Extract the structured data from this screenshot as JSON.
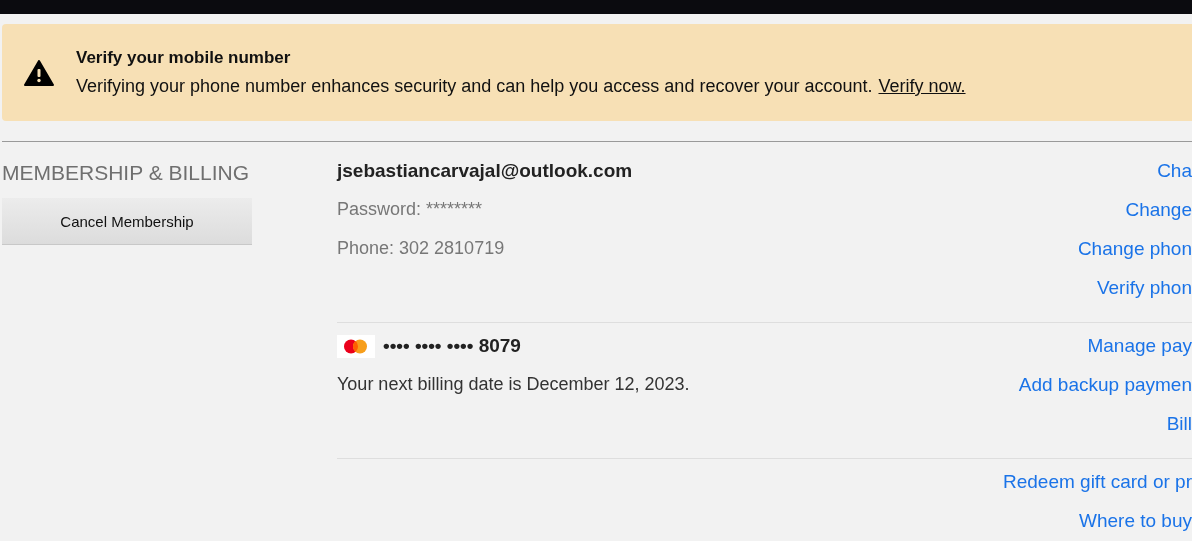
{
  "banner": {
    "title": "Verify your mobile number",
    "message": "Verifying your phone number enhances security and can help you access and recover your account.",
    "link": "Verify now."
  },
  "sidebar": {
    "heading": "MEMBERSHIP & BILLING",
    "button": "Cancel Membership"
  },
  "sections": [
    {
      "details": [
        {
          "kind": "email",
          "text": "jsebastiancarvajal@outlook.com"
        },
        {
          "kind": "muted",
          "text": "Password: ********"
        },
        {
          "kind": "muted",
          "text": "Phone: 302 2810719"
        }
      ],
      "links": [
        "Cha",
        "Change",
        "Change phon",
        "Verify phon"
      ]
    },
    {
      "details": [
        {
          "kind": "card",
          "text": "•••• •••• •••• 8079"
        },
        {
          "kind": "plain",
          "text": "Your next billing date is December 12, 2023."
        }
      ],
      "links": [
        "Manage pay",
        "Add backup paymen",
        "Bill"
      ]
    },
    {
      "links": [
        "Redeem gift card or pr",
        "Where to buy"
      ]
    }
  ]
}
